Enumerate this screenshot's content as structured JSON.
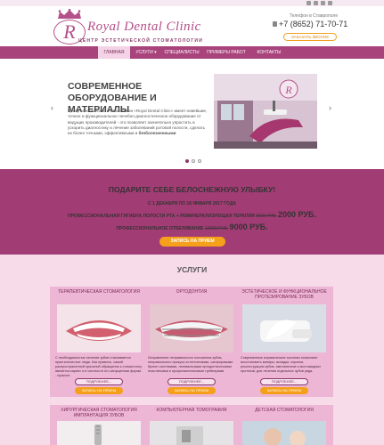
{
  "header": {
    "logo_letter": "R",
    "logo_title": "Royal Dental Clinic",
    "logo_subtitle": "ЦЕНТР ЭСТЕТИЧЕСКОЙ СТОМАТОЛОГИИ",
    "phone_caption": "Телефон в Ставрополе",
    "phone_number": "+7 (8652) 71-70-71",
    "callback_label": "ЗАКАЗАТЬ ЗВОНОК"
  },
  "social_icons": [
    "mail-icon",
    "facebook-icon",
    "instagram-icon",
    "vk-icon"
  ],
  "nav": {
    "items": [
      {
        "label": "ГЛАВНАЯ",
        "active": true
      },
      {
        "label": "УСЛУГИ ▾",
        "active": false
      },
      {
        "label": "СПЕЦИАЛИСТЫ",
        "active": false
      },
      {
        "label": "ПРИМЕРЫ РАБОТ",
        "active": false
      },
      {
        "label": "КОНТАКТЫ",
        "active": false
      }
    ]
  },
  "slider": {
    "title": "СОВРЕМЕННОЕ ОБОРУДОВАНИЕ И МАТЕРИАЛЫ",
    "text_before": "Центр эстетической стоматологии «Royal Dental Clinic» имеет новейшие, точное и функциональное лечебно-диагностическое оборудование от ведущих производителей - это позволяет значительно упростить и ускорить диагностику и лечение заболеваний ротовой полости, сделать их более точными, эффективными и ",
    "text_bold": "безболезненными",
    "prev_arrow": "‹",
    "next_arrow": "›",
    "dots": [
      true,
      false,
      false
    ]
  },
  "promo": {
    "title": "ПОДАРИТЕ СЕБЕ БЕЛОСНЕЖНУЮ УЛЫБКУ!",
    "dates": "С 1 ДЕКАБРЯ ПО 18 ЯНВАРЯ 2017 ГОДА",
    "line1": {
      "text": "ПРОФЕССИОНАЛЬНАЯ ГИГИЕНА ПОЛОСТИ РТА + РЕМИНЕРАЛИЗУЮЩАЯ ТЕРАПИЯ",
      "old": "2600 РУБ.",
      "new": "2000 РУБ."
    },
    "line2": {
      "text": "ПРОФЕССИОНАЛЬНОЕ ОТБЕЛИВАНИЕ",
      "old": "12000 РУБ.",
      "new": "9000 РУБ."
    },
    "button_label": "ЗАПИСЬ НА ПРИЕМ"
  },
  "services": {
    "title": "УСЛУГИ",
    "more_label": "ПОДРОБНЕЕ...",
    "book_label": "ЗАПИСЬ НА ПРИЕМ",
    "cards": [
      {
        "title": "ТЕРАПЕВТИЧЕСКАЯ СТОМАТОЛОГИЯ",
        "text": "С необходимостью лечения зубов сталкивается практически все люди. Как правило, самой распространенной причиной обращения к стоматологу является кариес и в частности его запущенная форма - пульпит."
      },
      {
        "title": "ОРТОДОНТИЯ",
        "text": "Исправление неправильного положения зубов, неправильного прикуса эстетическими, сапфировыми брекет-системами, лингвальными ортодонтическими пластинками и профилактическими трейнерами."
      },
      {
        "title": "ЭСТЕТИЧЕСКОЕ И ФУНКЦИОНАЛЬНОЕ ПРОТЕЗИРОВАНИЕ ЗУБОВ",
        "text": "Современные керамические системы позволяют восстановить виниры, вкладки, коронки, реконструкцию зубов, имплантатов и мостовидных протезов, для лечения отдельных зубов ряда."
      },
      {
        "title": "ХИРУРГИЧЕСКАЯ СТОМАТОЛОГИЯ ИМПЛАНТАЦИЯ ЗУБОВ"
      },
      {
        "title": "КОМПЬЮТЕРНАЯ ТОМОГРАФИЯ"
      },
      {
        "title": "ДЕТСКАЯ СТОМАТОЛОГИЯ"
      }
    ]
  },
  "colors": {
    "brand": "#a8437c",
    "promo_bg": "#a23c74",
    "services_bg": "#f8dbe9",
    "card_bg": "#eeb6d5",
    "accent": "#f5a01a"
  }
}
